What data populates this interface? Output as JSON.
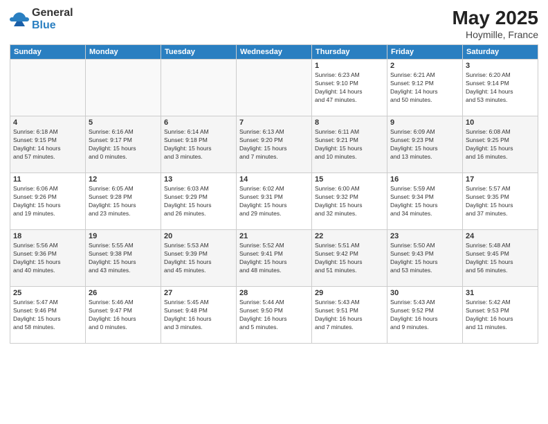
{
  "header": {
    "logo_general": "General",
    "logo_blue": "Blue",
    "month_year": "May 2025",
    "location": "Hoymille, France"
  },
  "weekdays": [
    "Sunday",
    "Monday",
    "Tuesday",
    "Wednesday",
    "Thursday",
    "Friday",
    "Saturday"
  ],
  "weeks": [
    [
      {
        "day": "",
        "info": "",
        "empty": true
      },
      {
        "day": "",
        "info": "",
        "empty": true
      },
      {
        "day": "",
        "info": "",
        "empty": true
      },
      {
        "day": "",
        "info": "",
        "empty": true
      },
      {
        "day": "1",
        "info": "Sunrise: 6:23 AM\nSunset: 9:10 PM\nDaylight: 14 hours\nand 47 minutes.",
        "empty": false
      },
      {
        "day": "2",
        "info": "Sunrise: 6:21 AM\nSunset: 9:12 PM\nDaylight: 14 hours\nand 50 minutes.",
        "empty": false
      },
      {
        "day": "3",
        "info": "Sunrise: 6:20 AM\nSunset: 9:14 PM\nDaylight: 14 hours\nand 53 minutes.",
        "empty": false
      }
    ],
    [
      {
        "day": "4",
        "info": "Sunrise: 6:18 AM\nSunset: 9:15 PM\nDaylight: 14 hours\nand 57 minutes.",
        "empty": false
      },
      {
        "day": "5",
        "info": "Sunrise: 6:16 AM\nSunset: 9:17 PM\nDaylight: 15 hours\nand 0 minutes.",
        "empty": false
      },
      {
        "day": "6",
        "info": "Sunrise: 6:14 AM\nSunset: 9:18 PM\nDaylight: 15 hours\nand 3 minutes.",
        "empty": false
      },
      {
        "day": "7",
        "info": "Sunrise: 6:13 AM\nSunset: 9:20 PM\nDaylight: 15 hours\nand 7 minutes.",
        "empty": false
      },
      {
        "day": "8",
        "info": "Sunrise: 6:11 AM\nSunset: 9:21 PM\nDaylight: 15 hours\nand 10 minutes.",
        "empty": false
      },
      {
        "day": "9",
        "info": "Sunrise: 6:09 AM\nSunset: 9:23 PM\nDaylight: 15 hours\nand 13 minutes.",
        "empty": false
      },
      {
        "day": "10",
        "info": "Sunrise: 6:08 AM\nSunset: 9:25 PM\nDaylight: 15 hours\nand 16 minutes.",
        "empty": false
      }
    ],
    [
      {
        "day": "11",
        "info": "Sunrise: 6:06 AM\nSunset: 9:26 PM\nDaylight: 15 hours\nand 19 minutes.",
        "empty": false
      },
      {
        "day": "12",
        "info": "Sunrise: 6:05 AM\nSunset: 9:28 PM\nDaylight: 15 hours\nand 23 minutes.",
        "empty": false
      },
      {
        "day": "13",
        "info": "Sunrise: 6:03 AM\nSunset: 9:29 PM\nDaylight: 15 hours\nand 26 minutes.",
        "empty": false
      },
      {
        "day": "14",
        "info": "Sunrise: 6:02 AM\nSunset: 9:31 PM\nDaylight: 15 hours\nand 29 minutes.",
        "empty": false
      },
      {
        "day": "15",
        "info": "Sunrise: 6:00 AM\nSunset: 9:32 PM\nDaylight: 15 hours\nand 32 minutes.",
        "empty": false
      },
      {
        "day": "16",
        "info": "Sunrise: 5:59 AM\nSunset: 9:34 PM\nDaylight: 15 hours\nand 34 minutes.",
        "empty": false
      },
      {
        "day": "17",
        "info": "Sunrise: 5:57 AM\nSunset: 9:35 PM\nDaylight: 15 hours\nand 37 minutes.",
        "empty": false
      }
    ],
    [
      {
        "day": "18",
        "info": "Sunrise: 5:56 AM\nSunset: 9:36 PM\nDaylight: 15 hours\nand 40 minutes.",
        "empty": false
      },
      {
        "day": "19",
        "info": "Sunrise: 5:55 AM\nSunset: 9:38 PM\nDaylight: 15 hours\nand 43 minutes.",
        "empty": false
      },
      {
        "day": "20",
        "info": "Sunrise: 5:53 AM\nSunset: 9:39 PM\nDaylight: 15 hours\nand 45 minutes.",
        "empty": false
      },
      {
        "day": "21",
        "info": "Sunrise: 5:52 AM\nSunset: 9:41 PM\nDaylight: 15 hours\nand 48 minutes.",
        "empty": false
      },
      {
        "day": "22",
        "info": "Sunrise: 5:51 AM\nSunset: 9:42 PM\nDaylight: 15 hours\nand 51 minutes.",
        "empty": false
      },
      {
        "day": "23",
        "info": "Sunrise: 5:50 AM\nSunset: 9:43 PM\nDaylight: 15 hours\nand 53 minutes.",
        "empty": false
      },
      {
        "day": "24",
        "info": "Sunrise: 5:48 AM\nSunset: 9:45 PM\nDaylight: 15 hours\nand 56 minutes.",
        "empty": false
      }
    ],
    [
      {
        "day": "25",
        "info": "Sunrise: 5:47 AM\nSunset: 9:46 PM\nDaylight: 15 hours\nand 58 minutes.",
        "empty": false
      },
      {
        "day": "26",
        "info": "Sunrise: 5:46 AM\nSunset: 9:47 PM\nDaylight: 16 hours\nand 0 minutes.",
        "empty": false
      },
      {
        "day": "27",
        "info": "Sunrise: 5:45 AM\nSunset: 9:48 PM\nDaylight: 16 hours\nand 3 minutes.",
        "empty": false
      },
      {
        "day": "28",
        "info": "Sunrise: 5:44 AM\nSunset: 9:50 PM\nDaylight: 16 hours\nand 5 minutes.",
        "empty": false
      },
      {
        "day": "29",
        "info": "Sunrise: 5:43 AM\nSunset: 9:51 PM\nDaylight: 16 hours\nand 7 minutes.",
        "empty": false
      },
      {
        "day": "30",
        "info": "Sunrise: 5:43 AM\nSunset: 9:52 PM\nDaylight: 16 hours\nand 9 minutes.",
        "empty": false
      },
      {
        "day": "31",
        "info": "Sunrise: 5:42 AM\nSunset: 9:53 PM\nDaylight: 16 hours\nand 11 minutes.",
        "empty": false
      }
    ]
  ]
}
